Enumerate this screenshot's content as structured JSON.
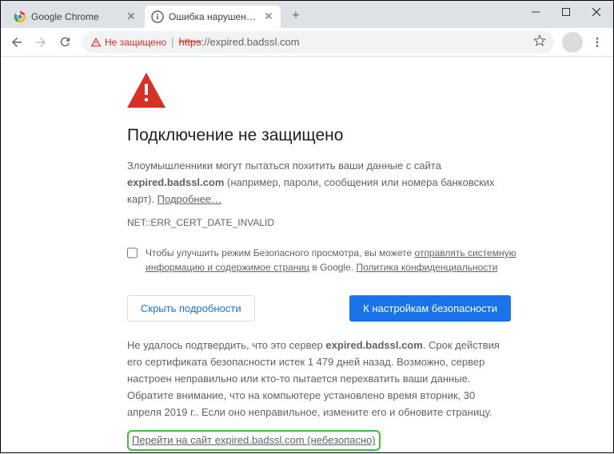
{
  "tabs": [
    {
      "title": "Google Chrome",
      "active": false,
      "favicon": "chrome"
    },
    {
      "title": "Ошибка нарушения конфиденциальности",
      "active": true,
      "favicon": "info"
    }
  ],
  "toolbar": {
    "security_label": "Не защищено",
    "url_https": "https",
    "url_rest": "://expired.badssl.com"
  },
  "page": {
    "title": "Подключение не защищено",
    "intro_pre": "Злоумышленники могут пытаться похитить ваши данные с сайта ",
    "intro_host": "expired.badssl.com",
    "intro_post": " (например, пароли, сообщения или номера банковских карт). ",
    "learn_more": "Подробнее…",
    "error_code": "NET::ERR_CERT_DATE_INVALID",
    "report_pre": "Чтобы улучшить режим Безопасного просмотра, вы можете ",
    "report_link1": "отправлять системную информацию и содержимое страниц",
    "report_mid": " в Google. ",
    "report_link2": "Политика конфиденциальности",
    "hide_details": "Скрыть подробности",
    "to_safety": "К настройкам безопасности",
    "details_pre": "Не удалось подтвердить, что это сервер ",
    "details_host": "expired.badssl.com",
    "details_post": ". Срок действия его сертификата безопасности истек 1 479 дней назад. Возможно, сервер настроен неправильно или кто-то пытается перехватить ваши данные. Обратите внимание, что на компьютере установлено время вторник, 30 апреля 2019 г.. Если оно неправильное, измените его и обновите страницу.",
    "proceed": "Перейти на сайт expired.badssl.com (небезопасно)"
  }
}
